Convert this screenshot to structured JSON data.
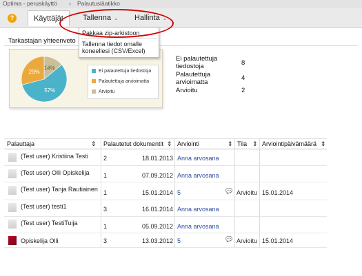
{
  "breadcrumb": {
    "root": "Optima - peruskäyttö",
    "sep": "›",
    "current": "Palautusläatikko"
  },
  "menu": {
    "help": "?",
    "kayttajat": "Käyttäjät",
    "tallenna": "Tallenna",
    "hallinta": "Hallinta",
    "chev": "⌄"
  },
  "dropdown": {
    "item1": "Pakkaa zip-arkistoon",
    "item2_line1": "Tallenna tiedot omalle",
    "item2_line2": "koneellesi (CSV/Excel)"
  },
  "summary": {
    "title": "Tarkastajan yhteenveto"
  },
  "chart_data": {
    "type": "pie",
    "categories": [
      "Ei palautettuja tiedostoja",
      "Palautettuja arvioimatta",
      "Arvioitu"
    ],
    "values": [
      57,
      29,
      14
    ],
    "labels": [
      "57%",
      "29%",
      "14%"
    ],
    "colors": [
      "#4ab3c9",
      "#eba83c",
      "#c9bf98"
    ],
    "legend_position": "right"
  },
  "stats": [
    {
      "label_line1": "Ei palautettuja",
      "label_line2": "tiedostoja",
      "value": "8"
    },
    {
      "label_line1": "Palautettuja",
      "label_line2": "arvioimatta",
      "value": "4"
    },
    {
      "label_line1": "Arvioitu",
      "label_line2": "",
      "value": "2"
    }
  ],
  "table": {
    "headers": {
      "palauttaja": "Palauttaja",
      "dokumentit": "Palautetut dokumentit",
      "arviointi": "Arviointi",
      "tila": "Tila",
      "pvm": "Arviointipäivämäärä",
      "sort": "⇕"
    },
    "rows": [
      {
        "name": "(Test user) Kristiina Testi",
        "docs": "2",
        "date": "18.01.2013",
        "grade": "Anna arvosana",
        "tila": "",
        "pvm": ""
      },
      {
        "name": "(Test user) Olli Opiskelija",
        "docs": "1",
        "date": "07.09.2012",
        "grade": "Anna arvosana",
        "tila": "",
        "pvm": ""
      },
      {
        "name": "(Test user) Tanja Rautiainen",
        "docs": "1",
        "date": "15.01.2014",
        "grade": "5",
        "tila": "Arvioitu",
        "pvm": "15.01.2014"
      },
      {
        "name": "(Test user) testi1",
        "docs": "3",
        "date": "16.01.2014",
        "grade": "Anna arvosana",
        "tila": "",
        "pvm": ""
      },
      {
        "name": "(Test user) TestiTuija",
        "docs": "1",
        "date": "05.09.2012",
        "grade": "Anna arvosana",
        "tila": "",
        "pvm": ""
      },
      {
        "name": "Opiskelija Olli",
        "docs": "3",
        "date": "13.03.2012",
        "grade": "5",
        "tila": "Arvioitu",
        "pvm": "15.01.2014"
      }
    ]
  },
  "icons": {
    "comment": "💬"
  }
}
